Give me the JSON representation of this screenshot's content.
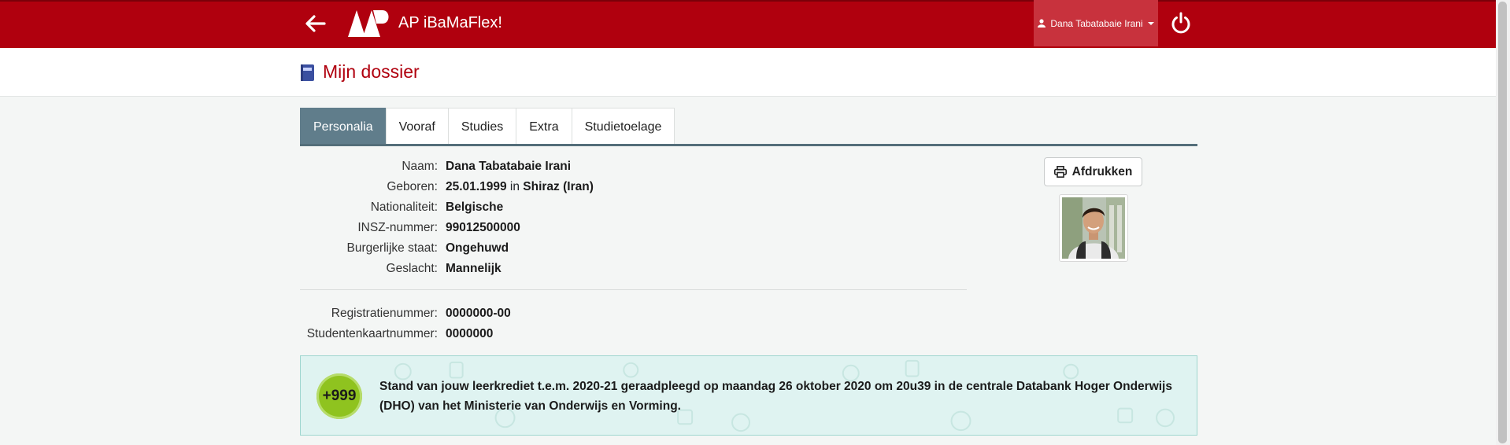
{
  "app": {
    "name": "AP iBaMaFlex!",
    "logo_text": "AP"
  },
  "user_menu": {
    "label": "Dana Tabatabaie Irani"
  },
  "page": {
    "title": "Mijn dossier"
  },
  "tabs": [
    {
      "label": "Personalia",
      "active": true
    },
    {
      "label": "Vooraf",
      "active": false
    },
    {
      "label": "Studies",
      "active": false
    },
    {
      "label": "Extra",
      "active": false
    },
    {
      "label": "Studietoelage",
      "active": false
    }
  ],
  "personalia": {
    "naam": {
      "label": "Naam:",
      "value": "Dana Tabatabaie Irani"
    },
    "geboren": {
      "label": "Geboren:",
      "date": "25.01.1999",
      "connector": "in",
      "place": "Shiraz (Iran)"
    },
    "nationaliteit": {
      "label": "Nationaliteit:",
      "value": "Belgische"
    },
    "insz": {
      "label": "INSZ-nummer:",
      "value": "99012500000"
    },
    "burgerlijke_staat": {
      "label": "Burgerlijke staat:",
      "value": "Ongehuwd"
    },
    "geslacht": {
      "label": "Geslacht:",
      "value": "Mannelijk"
    },
    "registratienummer": {
      "label": "Registratienummer:",
      "value": "0000000-00"
    },
    "studentenkaartnummer": {
      "label": "Studentenkaartnummer:",
      "value": "0000000"
    }
  },
  "print_button": {
    "label": "Afdrukken"
  },
  "leerkrediet": {
    "badge": "+999",
    "text": "Stand van jouw leerkrediet t.e.m. 2020-21 geraadpleegd op maandag 26 oktober 2020 om 20u39 in de centrale Databank Hoger Onderwijs (DHO) van het Ministerie van Onderwijs en Vorming."
  },
  "colors": {
    "brand": "#b0000e",
    "user_menu_bg": "#c8323d",
    "tab_active": "#607d8b",
    "credit_bg": "#dff3f1",
    "credit_badge": "#8fc31f"
  }
}
